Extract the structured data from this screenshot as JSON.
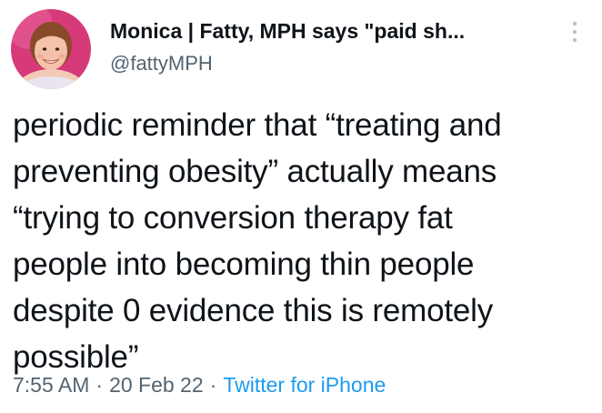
{
  "author": {
    "display_name": "Monica | Fatty, MPH says \"paid sh...",
    "handle": "@fattyMPH",
    "avatar_icon": "profile-photo"
  },
  "more_icon": "more-vertical-icon",
  "tweet": {
    "lines": [
      "periodic reminder that “treating and",
      "preventing obesity” actually means",
      "“trying to conversion therapy fat",
      "people into becoming thin people",
      "despite 0 evidence this is remotely",
      "possible”"
    ]
  },
  "meta": {
    "time": "7:55 AM",
    "date": "20 Feb 22",
    "separator": "·",
    "source": "Twitter for iPhone"
  },
  "colors": {
    "text": "#0f1419",
    "secondary": "#536471",
    "link": "#1d9bf0",
    "avatar_bg": "#d63a78"
  }
}
